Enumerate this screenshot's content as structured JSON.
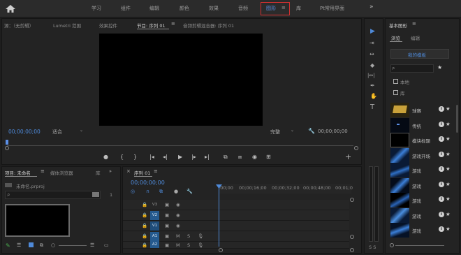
{
  "workspaces": [
    "学习",
    "组件",
    "编辑",
    "颜色",
    "效果",
    "音频",
    "图形",
    "库",
    "Pt常用界面"
  ],
  "active_workspace": "图形",
  "top_more": "»",
  "source_panel": {
    "tabs": [
      "源：（无剪辑）",
      "Lumetri 范围",
      "效果控件",
      "节目: 序列 01",
      "音频剪辑混合器: 序列 01"
    ],
    "active_tab": "节目: 序列 01",
    "timecode_left": "00;00;00;00",
    "fit": "适合",
    "quality": "完整",
    "timecode_right": "00;00;00;00",
    "transport": [
      "●",
      "{",
      "}",
      "|◂",
      "◂|",
      "▶",
      "|▸",
      "▸|",
      "⧉",
      "⧈",
      "◉",
      "⊞"
    ],
    "add_button": "+"
  },
  "project_panel": {
    "tabs": [
      "项目: 未命名",
      "媒体浏览器",
      "库"
    ],
    "active_tab": "项目: 未命名",
    "filename": "未命名.prproj",
    "count": "1"
  },
  "timeline_panel": {
    "tab": "序列 01",
    "timecode": "00;00;00;00",
    "ruler": [
      ":00;00",
      "00;00;16;00",
      "00;00;32;00",
      "00;00;48;00",
      "00;01;0"
    ],
    "video_tracks": [
      "V3",
      "V2",
      "V1"
    ],
    "audio_tracks": [
      "A1",
      "A2"
    ]
  },
  "tools": [
    "▶",
    "⇥",
    "↔",
    "◆",
    "|↔|",
    "✒",
    "✋",
    "T"
  ],
  "essential_graphics": {
    "title": "基本图形",
    "tabs": [
      "浏览",
      "编辑"
    ],
    "active_tab": "浏览",
    "my_templates": "我的模板",
    "checkbox_local": "本地",
    "checkbox_library": "库",
    "items": [
      "球赛",
      "传统",
      "模块标题",
      "游戏开场",
      "游戏",
      "游戏",
      "游戏",
      "游戏",
      "游戏"
    ],
    "footer": "S S"
  }
}
